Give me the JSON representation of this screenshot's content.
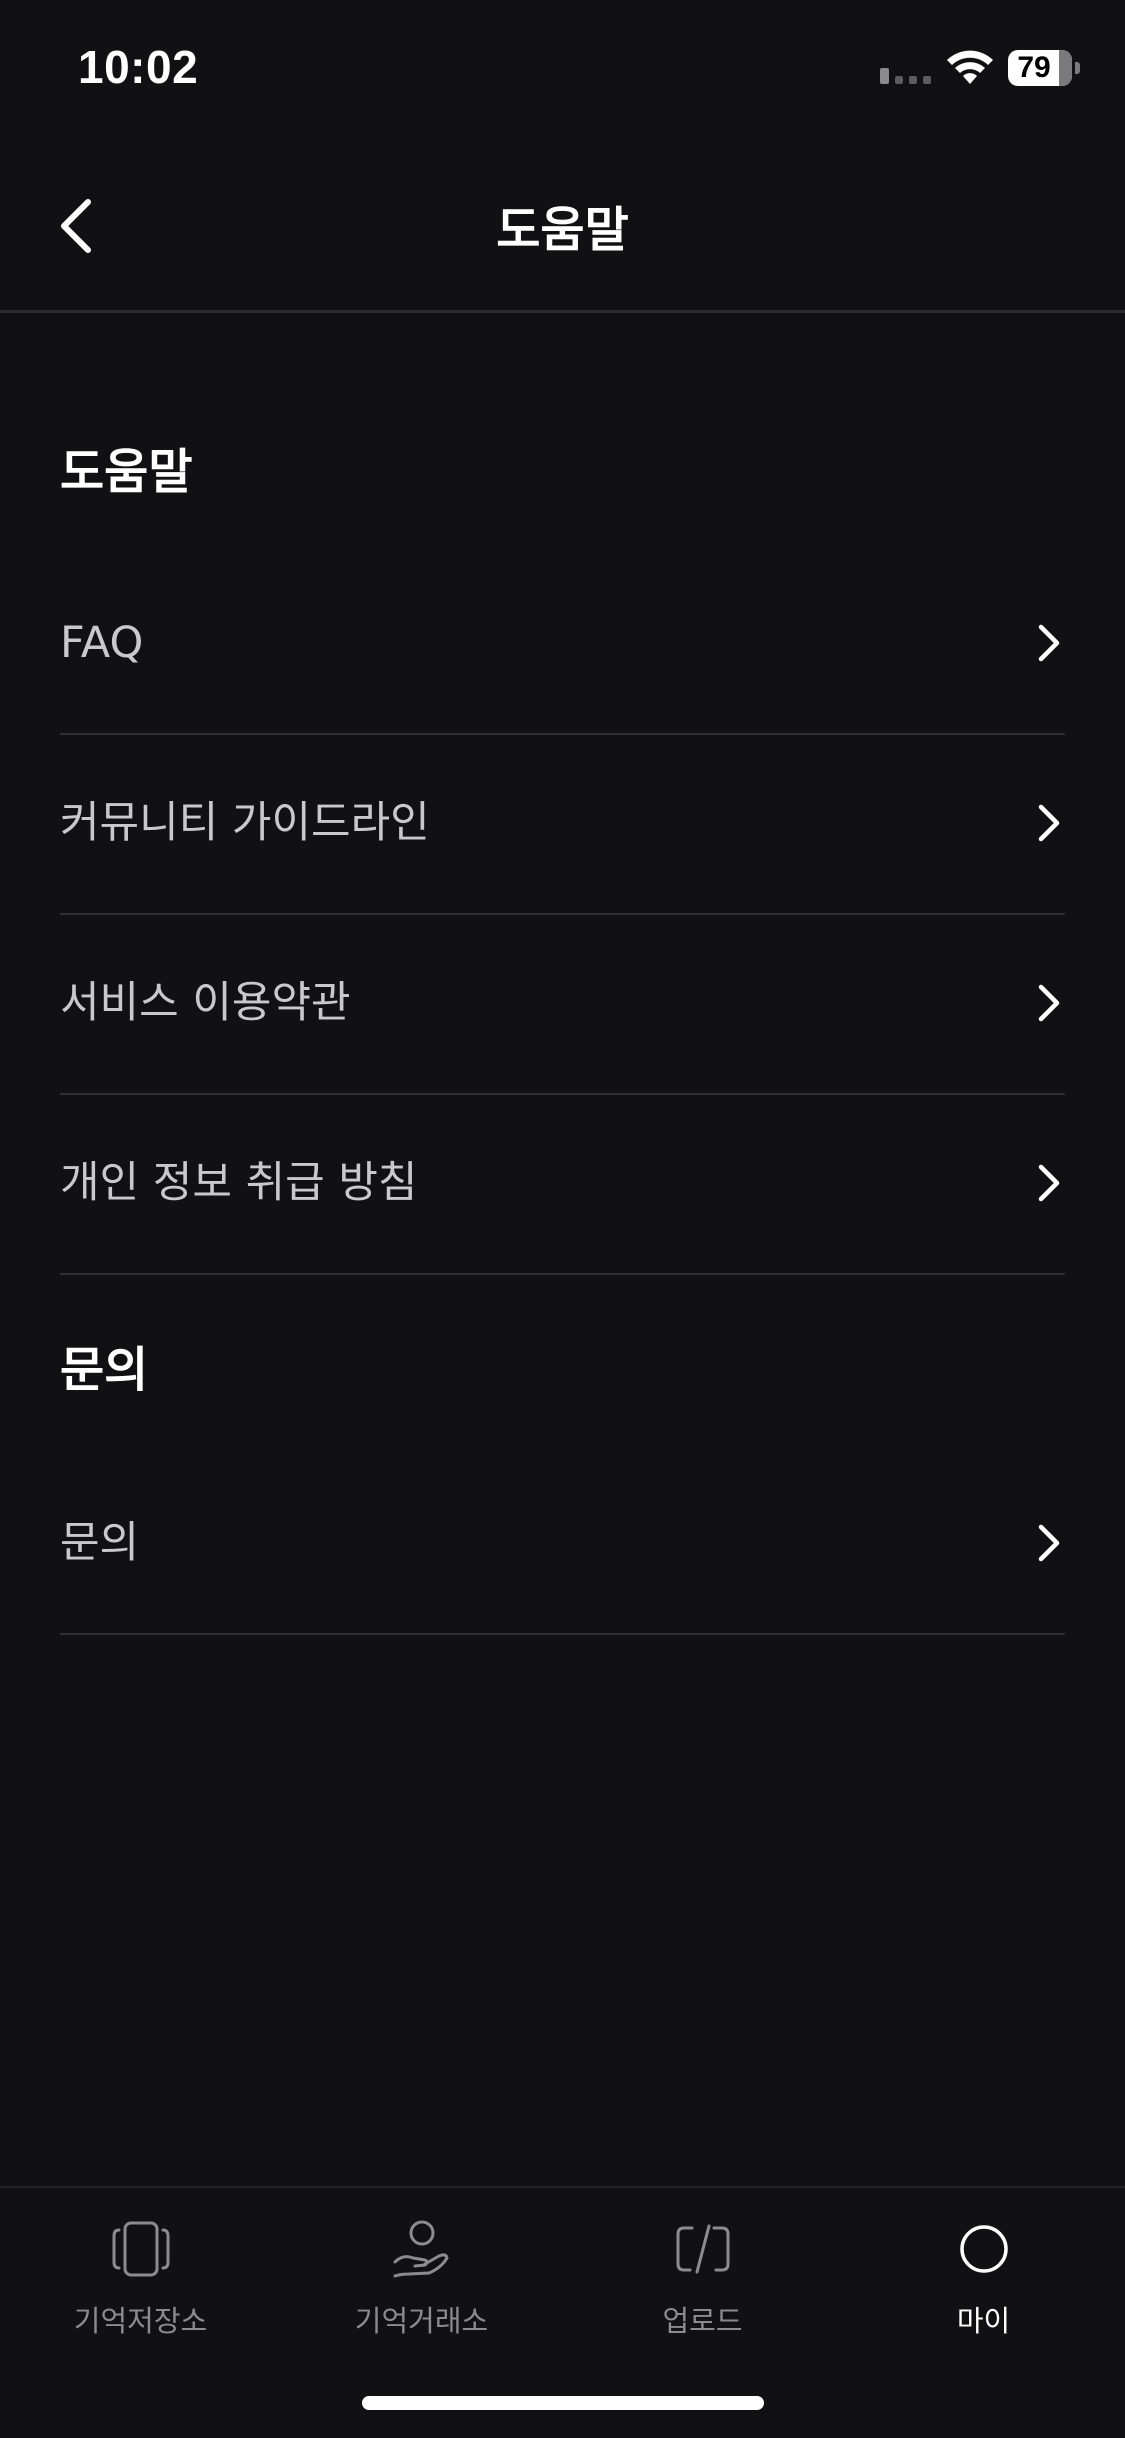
{
  "status_bar": {
    "time": "10:02",
    "battery_level": "79",
    "battery_fraction": 0.79
  },
  "header": {
    "title": "도움말"
  },
  "sections": [
    {
      "title": "도움말",
      "items": [
        {
          "label": "FAQ"
        },
        {
          "label": "커뮤니티 가이드라인"
        },
        {
          "label": "서비스 이용약관"
        },
        {
          "label": "개인 정보 취급 방침"
        }
      ]
    },
    {
      "title": "문의",
      "items": [
        {
          "label": "문의"
        }
      ]
    }
  ],
  "tab_bar": {
    "tabs": [
      {
        "label": "기억저장소",
        "icon": "memory-storage-icon",
        "active": false
      },
      {
        "label": "기억거래소",
        "icon": "memory-exchange-icon",
        "active": false
      },
      {
        "label": "업로드",
        "icon": "upload-icon",
        "active": false
      },
      {
        "label": "마이",
        "icon": "my-profile-icon",
        "active": true
      }
    ]
  },
  "colors": {
    "background": "#111113",
    "text_primary": "#ffffff",
    "text_secondary": "#c9c9cc",
    "tab_inactive": "#8c8c90",
    "divider": "#2f2f32"
  }
}
